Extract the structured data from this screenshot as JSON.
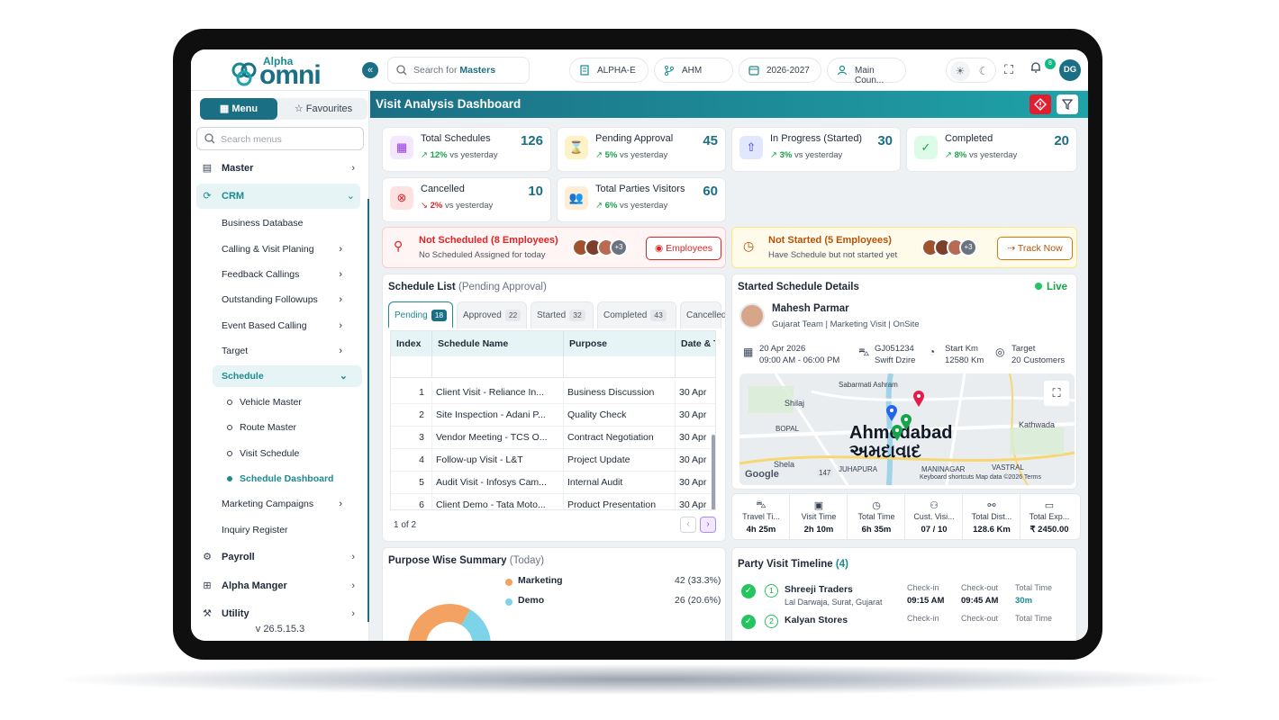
{
  "brand": {
    "small": "Alpha",
    "big": "omni"
  },
  "topbar": {
    "search_prefix": "Search for ",
    "search_highlight": "Masters",
    "company": "ALPHA-E",
    "branch": "AHM",
    "year": "2026-2027",
    "counter": "Main Coun...",
    "notif_count": "8",
    "user_initials": "DG"
  },
  "sidebar": {
    "tab_menu": "Menu",
    "tab_favourites": "Favourites",
    "search_placeholder": "Search menus",
    "items": {
      "master": "Master",
      "crm": "CRM",
      "payroll": "Payroll",
      "alpha_manger": "Alpha Manger",
      "utility": "Utility"
    },
    "crm_sub": {
      "business_database": "Business Database",
      "calling_visit": "Calling & Visit Planing",
      "feedback": "Feedback Callings",
      "outstanding": "Outstanding Followups",
      "event_calling": "Event Based Calling",
      "target": "Target",
      "schedule": "Schedule",
      "marketing": "Marketing Campaigns",
      "inquiry": "Inquiry Register"
    },
    "schedule_sub": {
      "vehicle": "Vehicle Master",
      "route": "Route Master",
      "visit": "Visit Schedule",
      "dashboard": "Schedule Dashboard"
    },
    "version": "v 26.5.15.3"
  },
  "page": {
    "title": "Visit Analysis Dashboard"
  },
  "kpis": {
    "total": {
      "label": "Total Schedules",
      "value": "126",
      "trend": "12%",
      "suffix": " vs yesterday"
    },
    "pending": {
      "label": "Pending Approval",
      "value": "45",
      "trend": "5%",
      "suffix": " vs yesterday"
    },
    "progress": {
      "label": "In Progress (Started)",
      "value": "30",
      "trend": "3%",
      "suffix": " vs yesterday"
    },
    "completed": {
      "label": "Completed",
      "value": "20",
      "trend": "8%",
      "suffix": " vs yesterday"
    },
    "cancelled": {
      "label": "Cancelled",
      "value": "10",
      "trend": "2%",
      "suffix": " vs yesterday"
    },
    "visitors": {
      "label": "Total Parties Visitors",
      "value": "60",
      "trend": "6%",
      "suffix": " vs yesterday"
    }
  },
  "alerts": {
    "not_scheduled": {
      "title": "Not Scheduled (8 Employees)",
      "desc": "No Scheduled Assigned for today",
      "more": "+3",
      "button": "Employees"
    },
    "not_started": {
      "title": "Not Started (5 Employees)",
      "desc": "Have Schedule but not started yet",
      "more": "+3",
      "button": "Track Now"
    }
  },
  "schedule_list": {
    "title": "Schedule List",
    "subtitle": "(Pending Approval)",
    "tabs": [
      {
        "label": "Pending",
        "count": "18"
      },
      {
        "label": "Approved",
        "count": "22"
      },
      {
        "label": "Started",
        "count": "32"
      },
      {
        "label": "Completed",
        "count": "43"
      },
      {
        "label": "Cancelled",
        "count": ""
      }
    ],
    "columns": [
      "Index",
      "Schedule Name",
      "Purpose",
      "Date & T"
    ],
    "rows": [
      {
        "index": "1",
        "name": "Client Visit - Reliance In...",
        "purpose": "Business Discussion",
        "date": "30 Apr"
      },
      {
        "index": "2",
        "name": "Site Inspection - Adani P...",
        "purpose": "Quality Check",
        "date": "30 Apr"
      },
      {
        "index": "3",
        "name": "Vendor Meeting - TCS O...",
        "purpose": "Contract Negotiation",
        "date": "30 Apr"
      },
      {
        "index": "4",
        "name": "Follow-up Visit - L&T",
        "purpose": "Project Update",
        "date": "30 Apr"
      },
      {
        "index": "5",
        "name": "Audit Visit - Infosys Cam...",
        "purpose": "Internal Audit",
        "date": "30 Apr"
      },
      {
        "index": "6",
        "name": "Client Demo - Tata Moto...",
        "purpose": "Product Presentation",
        "date": "30 Apr"
      }
    ],
    "pager": "1 of 2"
  },
  "started": {
    "title": "Started Schedule Details",
    "live": "Live",
    "name": "Mahesh Parmar",
    "meta": "Gujarat Team | Marketing Visit | OnSite",
    "date": "20 Apr 2026",
    "time": "09:00 AM - 06:00 PM",
    "vehicle_no": "GJ051234",
    "vehicle": "Swift Dzire",
    "start_km_label": "Start Km",
    "start_km": "12580 Km",
    "target_label": "Target",
    "target": "20 Customers",
    "map": {
      "city_en": "Ahmedabad",
      "city_gu": "અમદાવાદ",
      "labels": {
        "sabarmati": "Sabarmati Ashram",
        "shilaj": "Shilaj",
        "bopal": "BOPAL",
        "kathwada": "Kathwada",
        "shela": "Shela",
        "juhapura": "JUHAPURA",
        "maninagar": "MANINAGAR",
        "vastral": "VASTRAL"
      },
      "credits": "Keyboard shortcuts   Map data ©2026   Terms",
      "google": "Google",
      "road": "147"
    },
    "stats": [
      {
        "label": "Travel Ti...",
        "value": "4h 25m"
      },
      {
        "label": "Visit Time",
        "value": "2h 10m"
      },
      {
        "label": "Total Time",
        "value": "6h 35m"
      },
      {
        "label": "Cust. Visi...",
        "value": "07 / 10"
      },
      {
        "label": "Total Dist...",
        "value": "128.6 Km"
      },
      {
        "label": "Total Exp...",
        "value": "₹ 2450.00"
      }
    ]
  },
  "purpose": {
    "title": "Purpose Wise Summary",
    "subtitle": "(Today)",
    "chart_data": {
      "type": "pie",
      "categories": [
        "Marketing",
        "Demo"
      ],
      "values": [
        42,
        26
      ],
      "percents": [
        "(33.3%)",
        "(20.6%)"
      ],
      "colors": [
        "#f4a261",
        "#7dd3e8"
      ]
    }
  },
  "timeline": {
    "title": "Party Visit Timeline",
    "count": "(4)",
    "checkin_label": "Check-in",
    "checkout_label": "Check-out",
    "total_label": "Total Time",
    "rows": [
      {
        "num": "1",
        "name": "Shreeji Traders",
        "address": "Lal Darwaja, Surat, Gujarat",
        "checkin": "09:15 AM",
        "checkout": "09:45 AM",
        "total": "30m"
      },
      {
        "num": "2",
        "name": "Kalyan Stores",
        "address": "",
        "checkin": "",
        "checkout": "",
        "total": ""
      }
    ]
  }
}
